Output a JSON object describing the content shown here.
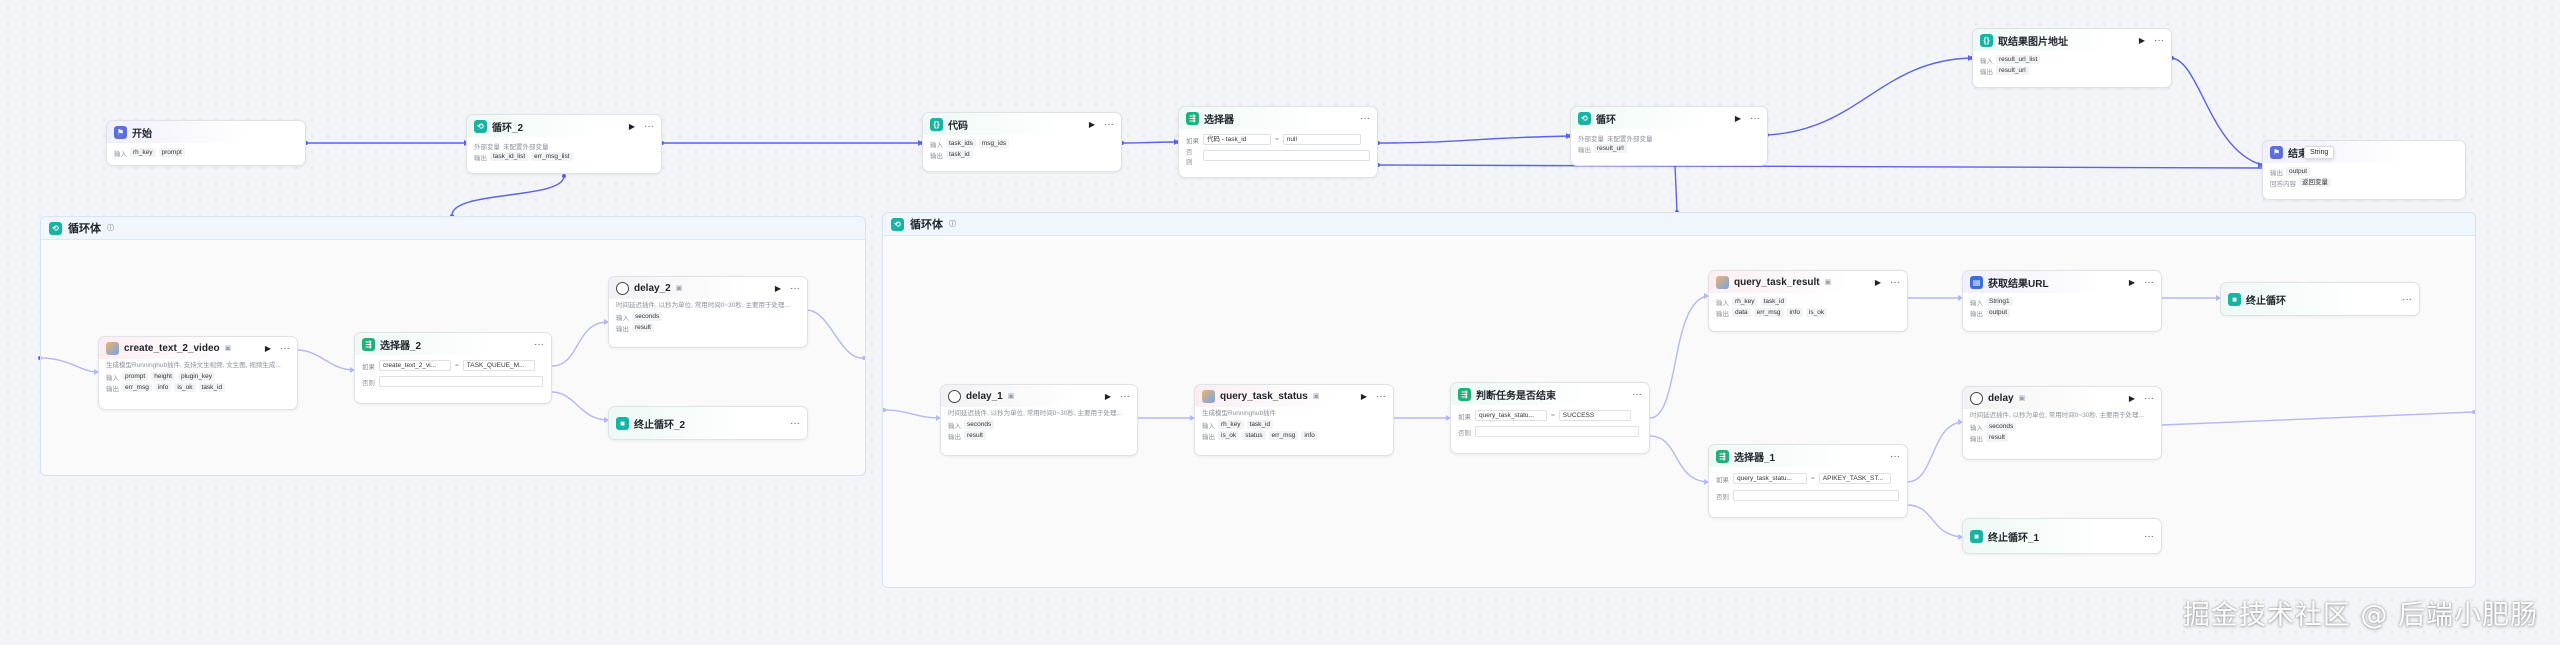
{
  "nodes": {
    "start": {
      "title": "开始",
      "in_label": "输入",
      "params": [
        "rh_key",
        "prompt"
      ]
    },
    "loop2": {
      "title": "循环_2",
      "desc": "外部变量",
      "desc_hint": "未配置外部变量",
      "out_label": "输出",
      "params": [
        "task_id_list",
        "err_msg_list"
      ]
    },
    "code": {
      "title": "代码",
      "in_label": "输入",
      "in_params": [
        "task_ids",
        "msg_ids"
      ],
      "out_label": "输出",
      "out_params": [
        "task_id"
      ]
    },
    "selector": {
      "title": "选择器",
      "if_label": "如果",
      "cond_left": "代码 - task_id",
      "cond_op": "=",
      "cond_right": "null",
      "else_label": "否则"
    },
    "loop": {
      "title": "循环",
      "desc": "外部变量",
      "desc_hint": "未配置外部变量",
      "out_label": "输出",
      "params": [
        "result_url"
      ]
    },
    "fetch_result": {
      "title": "取结果图片地址",
      "in_label": "输入",
      "in_params": [
        "result_url_list"
      ],
      "out_label": "输出",
      "out_params": [
        "result_url"
      ]
    },
    "end": {
      "title": "结束",
      "popup": "String",
      "out_label": "输出",
      "out_params": [
        "output"
      ],
      "ret_label": "回答内容",
      "ret_value": "返回变量"
    },
    "loop_body_left": {
      "title": "循环体"
    },
    "loop_body_right": {
      "title": "循环体"
    },
    "create_video": {
      "title": "create_text_2_video",
      "desc": "生成模型Runninghub插件, 支持文生视频, 文生图, 视频生成...",
      "in_label": "输入",
      "in_params": [
        "prompt",
        "height",
        "plugin_key"
      ],
      "out_label": "输出",
      "out_params": [
        "err_msg",
        "info",
        "is_ok",
        "task_id"
      ]
    },
    "selector2": {
      "title": "选择器_2",
      "if_label": "如果",
      "cond_left": "create_text_2_vi...",
      "cond_op": "=",
      "cond_right": "TASK_QUEUE_M...",
      "else_label": "否则"
    },
    "delay2": {
      "title": "delay_2",
      "desc": "时间延迟插件, 以秒为单位, 常用时间0~30秒, 主要用于处理...",
      "in_label": "输入",
      "in_params": [
        "seconds"
      ],
      "out_label": "输出",
      "out_params": [
        "result"
      ]
    },
    "stop2": {
      "title": "终止循环_2"
    },
    "delay1": {
      "title": "delay_1",
      "desc": "时间延迟插件, 以秒为单位, 常用时间0~30秒, 主要用于处理...",
      "in_label": "输入",
      "in_params": [
        "seconds"
      ],
      "out_label": "输出",
      "out_params": [
        "result"
      ]
    },
    "query_status": {
      "title": "query_task_status",
      "desc": "生成模型Runninghub插件",
      "in_label": "输入",
      "in_params": [
        "rh_key",
        "task_id"
      ],
      "out_label": "输出",
      "out_params": [
        "is_ok",
        "status",
        "err_msg",
        "info"
      ]
    },
    "judge": {
      "title": "判断任务是否结束",
      "if_label": "如果",
      "cond_left": "query_task_statu...",
      "cond_op": "=",
      "cond_right": "SUCCESS",
      "else_label": "否则"
    },
    "query_result": {
      "title": "query_task_result",
      "in_label": "输入",
      "in_params": [
        "rh_key",
        "task_id"
      ],
      "out_label": "输出",
      "out_params": [
        "data",
        "err_msg",
        "info",
        "is_ok"
      ]
    },
    "selector1": {
      "title": "选择器_1",
      "if_label": "如果",
      "cond_left": "query_task_statu...",
      "cond_op": "=",
      "cond_right": "APIKEY_TASK_ST...",
      "else_label": "否则"
    },
    "get_url": {
      "title": "获取结果URL",
      "in_label": "输入",
      "in_params": [
        "String1"
      ],
      "out_label": "输出",
      "out_params": [
        "output"
      ]
    },
    "stop": {
      "title": "终止循环"
    },
    "delay": {
      "title": "delay",
      "desc": "时间延迟插件, 以秒为单位, 常用时间0~30秒, 主要用于处理...",
      "in_label": "输入",
      "in_params": [
        "seconds"
      ],
      "out_label": "输出",
      "out_params": [
        "result"
      ]
    },
    "stop1": {
      "title": "终止循环_1"
    }
  },
  "watermark": "掘金技术社区 @ 后端小肥肠"
}
